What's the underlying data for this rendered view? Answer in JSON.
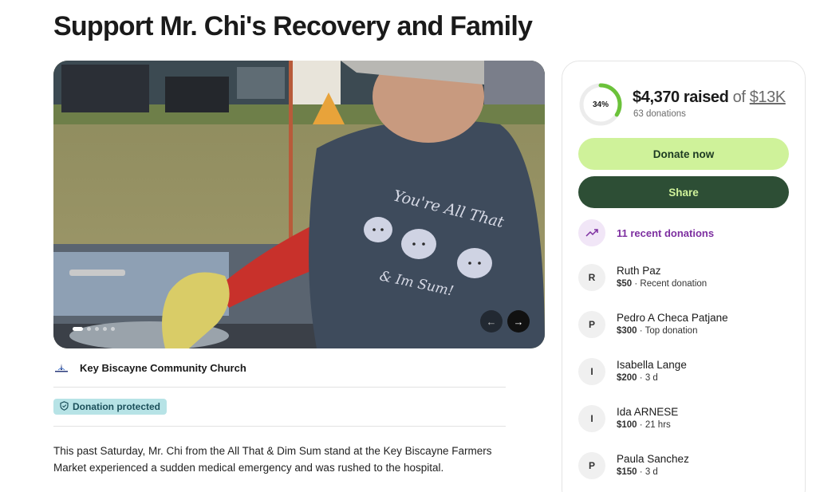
{
  "page": {
    "title": "Support Mr. Chi's Recovery and Family"
  },
  "hero": {
    "shirt_text_line1": "You're All That",
    "shirt_text_line2": "& Im Sum!",
    "slide_count": 5,
    "active_slide": 1
  },
  "organizer": {
    "name": "Key Biscayne Community Church"
  },
  "badge": {
    "label": "Donation protected"
  },
  "story": {
    "text": "This past Saturday, Mr. Chi from the All That & Dim Sum stand at the Key Biscayne Farmers Market experienced a sudden medical emergency and was rushed to the hospital."
  },
  "fundraiser": {
    "percent_label": "34%",
    "percent_value": 0.34,
    "raised": "$4,370 raised",
    "of": "of",
    "goal": "$13K",
    "donations_count": "63 donations",
    "donate_label": "Donate now",
    "share_label": "Share",
    "recent_label": "11 recent donations"
  },
  "donors": [
    {
      "initial": "R",
      "name": "Ruth Paz",
      "amount": "$50",
      "note": " · Recent donation"
    },
    {
      "initial": "P",
      "name": "Pedro A Checa Patjane",
      "amount": "$300",
      "note": " · Top donation"
    },
    {
      "initial": "I",
      "name": "Isabella Lange",
      "amount": "$200",
      "note": " · 3 d"
    },
    {
      "initial": "I",
      "name": "Ida ARNESE",
      "amount": "$100",
      "note": " · 21 hrs"
    },
    {
      "initial": "P",
      "name": "Paula Sanchez",
      "amount": "$150",
      "note": " · 3 d"
    }
  ],
  "colors": {
    "donate_bg": "#cff29a",
    "share_bg": "#2d4e35",
    "progress": "#6bc23a",
    "badge_bg": "#b7e3e6",
    "accent_purple": "#7d2fa0"
  }
}
